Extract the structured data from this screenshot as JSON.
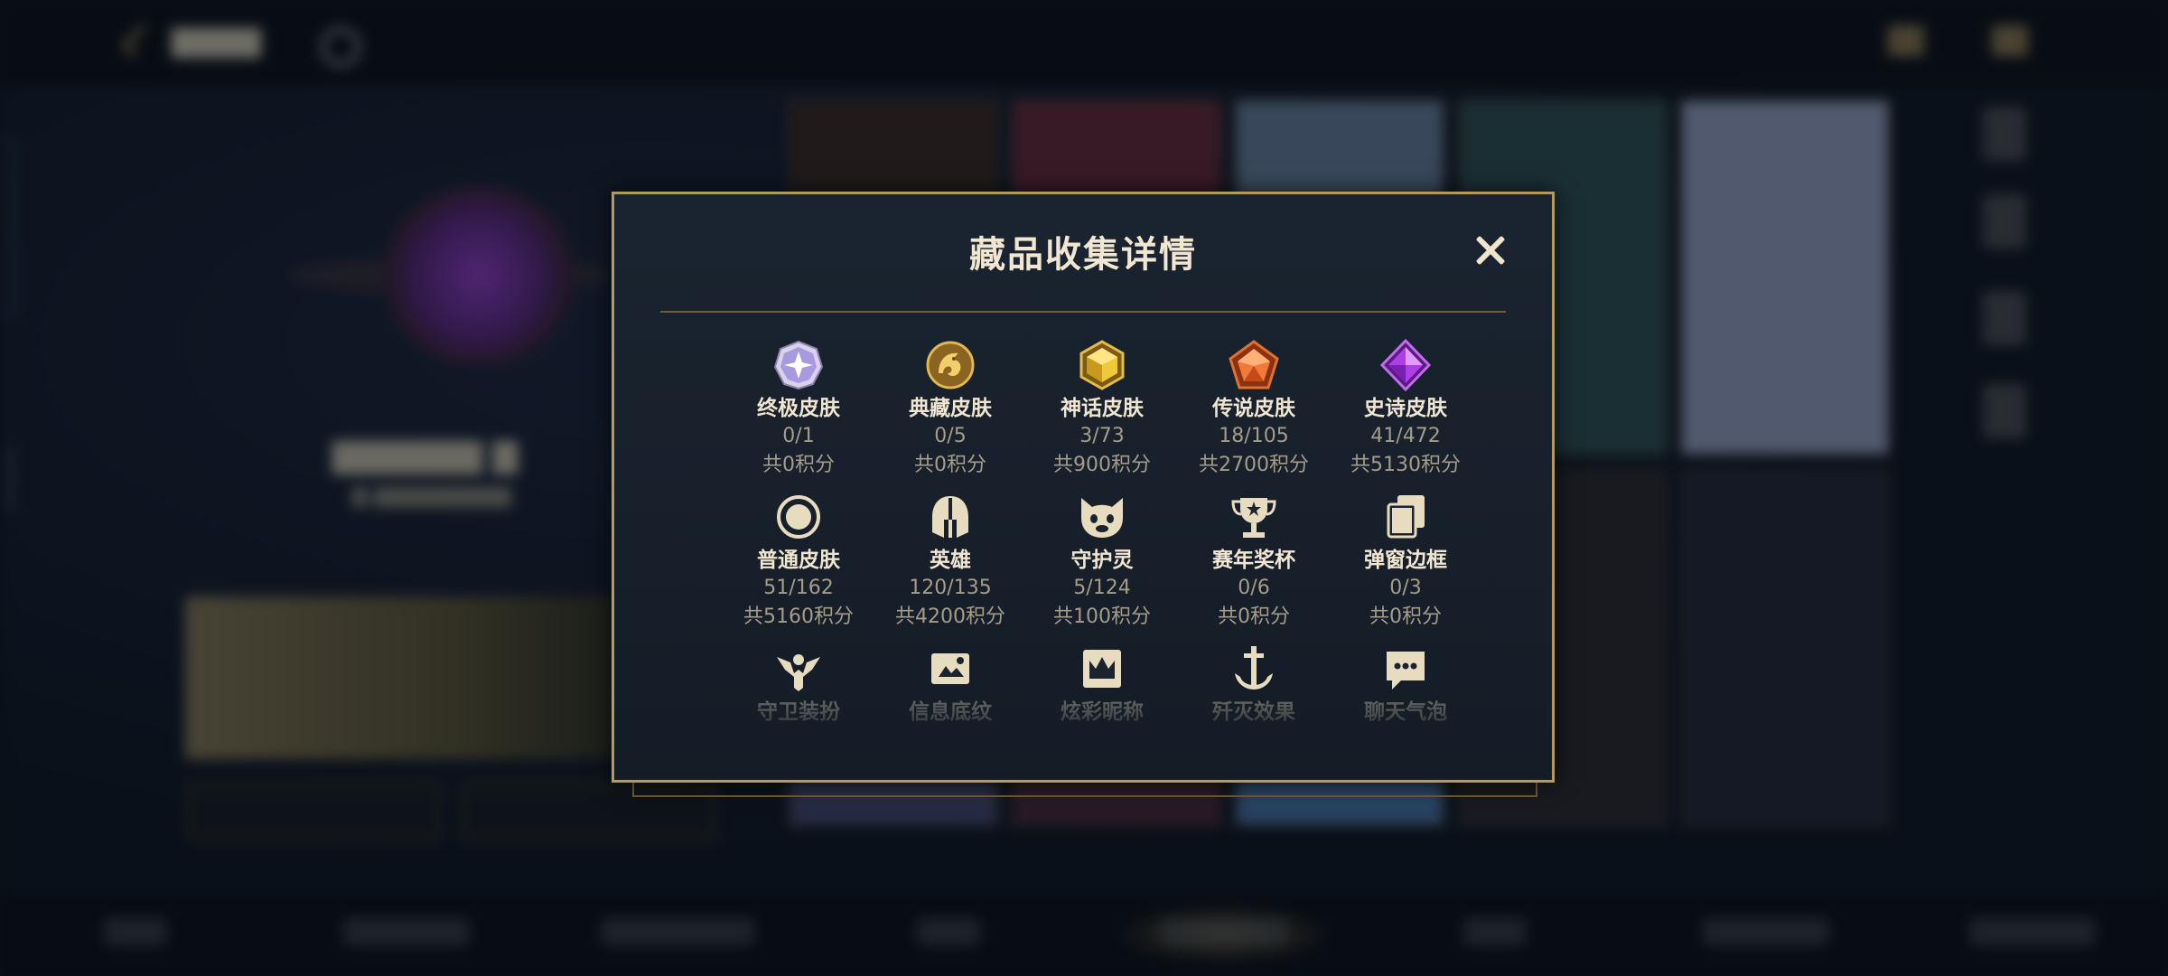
{
  "modal": {
    "title": "藏品收集详情",
    "close_icon": "close-icon"
  },
  "categories_row1": [
    {
      "label": "终极皮肤",
      "count": "0/1",
      "points": "共0积分",
      "icon": "ultimate-skin-icon"
    },
    {
      "label": "典藏皮肤",
      "count": "0/5",
      "points": "共0积分",
      "icon": "prestige-skin-icon"
    },
    {
      "label": "神话皮肤",
      "count": "3/73",
      "points": "共900积分",
      "icon": "mythic-skin-icon"
    },
    {
      "label": "传说皮肤",
      "count": "18/105",
      "points": "共2700积分",
      "icon": "legendary-skin-icon"
    },
    {
      "label": "史诗皮肤",
      "count": "41/472",
      "points": "共5130积分",
      "icon": "epic-skin-icon"
    }
  ],
  "categories_row2": [
    {
      "label": "普通皮肤",
      "count": "51/162",
      "points": "共5160积分",
      "icon": "standard-skin-icon"
    },
    {
      "label": "英雄",
      "count": "120/135",
      "points": "共4200积分",
      "icon": "champion-helmet-icon"
    },
    {
      "label": "守护灵",
      "count": "5/124",
      "points": "共100积分",
      "icon": "little-legend-icon"
    },
    {
      "label": "赛年奖杯",
      "count": "0/6",
      "points": "共0积分",
      "icon": "trophy-icon"
    },
    {
      "label": "弹窗边框",
      "count": "0/3",
      "points": "共0积分",
      "icon": "frame-cards-icon"
    }
  ],
  "categories_row3": [
    {
      "label": "守卫装扮",
      "icon": "ward-icon"
    },
    {
      "label": "信息底纹",
      "icon": "banner-icon"
    },
    {
      "label": "炫彩昵称",
      "icon": "crown-icon"
    },
    {
      "label": "歼灭效果",
      "icon": "anchor-sword-icon"
    },
    {
      "label": "聊天气泡",
      "icon": "chat-bubble-icon"
    }
  ],
  "background": {
    "profile_id": "6449493"
  }
}
